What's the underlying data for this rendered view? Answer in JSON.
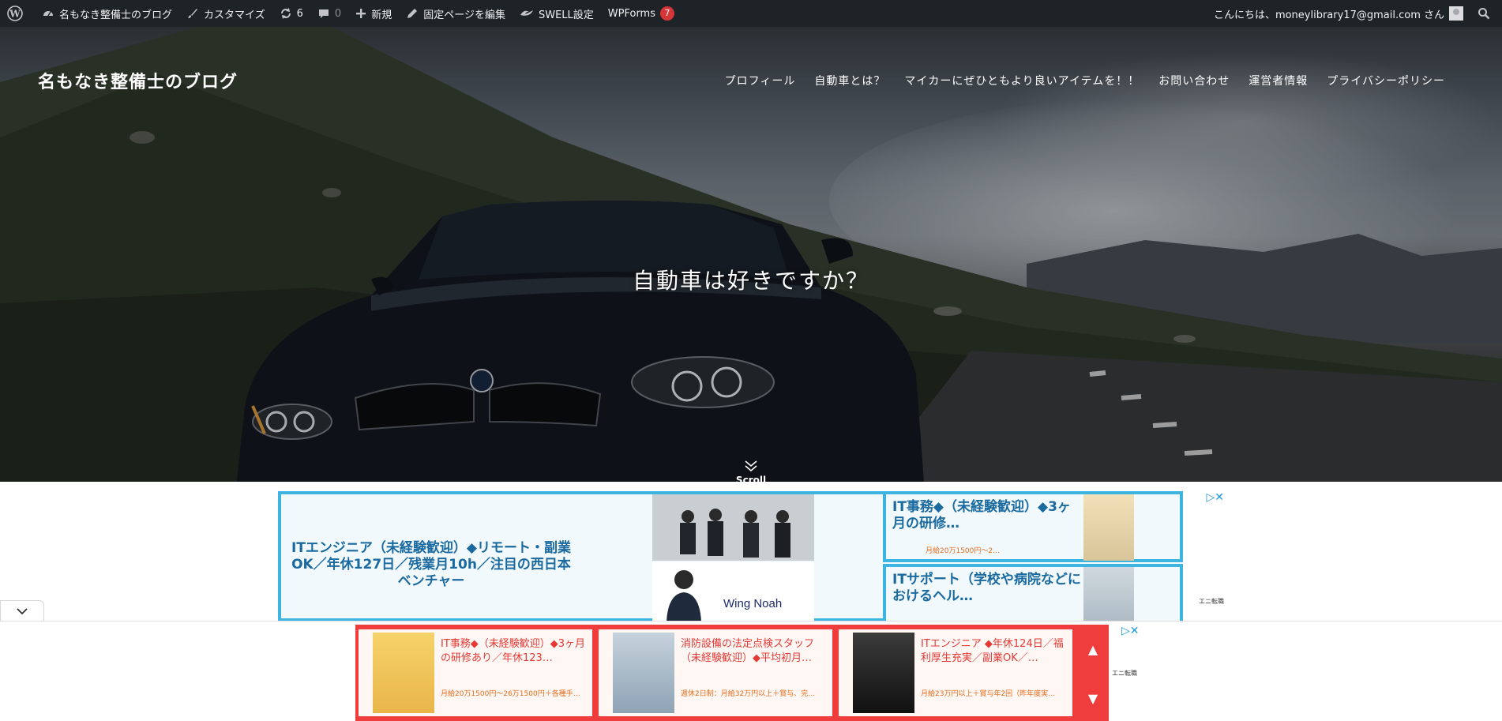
{
  "adminbar": {
    "site_name": "名もなき整備士のブログ",
    "customize": "カスタマイズ",
    "updates_count": "6",
    "comments_count": "0",
    "new": "新規",
    "edit_page": "固定ページを編集",
    "swell": "SWELL設定",
    "wpforms": "WPForms",
    "wpforms_badge": "7",
    "greeting": "こんにちは、moneylibrary17@gmail.com さん"
  },
  "header": {
    "site_title": "名もなき整備士のブログ",
    "nav": [
      "プロフィール",
      "自動車とは？",
      "マイカーにぜひともより良いアイテムを！！",
      "お問い合わせ",
      "運営者情報",
      "プライバシーポリシー"
    ]
  },
  "hero": {
    "catch": "自動車は好きですか？",
    "scroll": "Scroll"
  },
  "ad_inline": {
    "big_title": "ITエンジニア（未経験歓迎）◆リモート・副業OK／年休127日／残業月10h／注目の西日本ベンチャー",
    "big_brand": "Wing Noah",
    "small1_title": "IT事務◆（未経験歓迎）◆3ヶ月の研修…",
    "small1_sub": "月給20万1500円～2…",
    "small2_title": "ITサポート（学校や病院などにおけるヘル…",
    "brand_mini": "エニ転職"
  },
  "anchor_ad": {
    "cards": [
      {
        "title": "IT事務◆（未経験歓迎）◆3ヶ月の研修あり／年休123…",
        "sub": "月給20万1500円～26万1500円＋各種手…"
      },
      {
        "title": "消防設備の法定点検スタッフ（未経験歓迎）◆平均初月…",
        "sub": "週休2日制：月給32万円以上＋賞与、完…"
      },
      {
        "title": "ITエンジニア ◆年休124日／福利厚生充実／副業OK／…",
        "sub": "月給23万円以上＋賞与年2回（昨年度実…"
      }
    ],
    "brand_mini": "エニ転職"
  },
  "colors": {
    "adminbar_bg": "#1d2327",
    "ad_border": "#3eb4e0",
    "ad_text": "#1a6aa0",
    "anchor_bg": "#ef3d3d",
    "badge": "#d63638"
  }
}
